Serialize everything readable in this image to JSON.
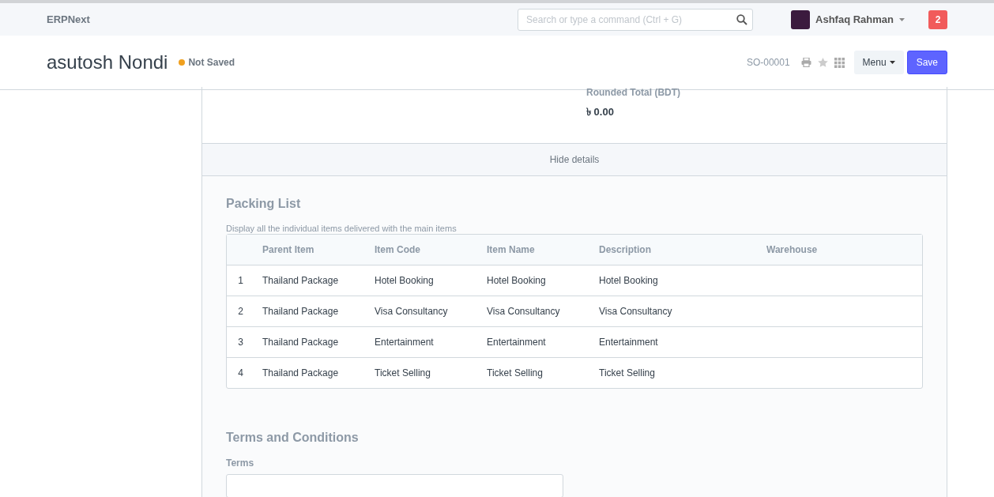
{
  "navbar": {
    "brand": "ERPNext",
    "search": {
      "placeholder": "Search or type a command (Ctrl + G)"
    },
    "user": {
      "name": "Ashfaq Rahman"
    },
    "notifications": "2"
  },
  "page_header": {
    "title": "asutosh Nondi",
    "status": {
      "label": "Not Saved",
      "color": "#f0a01e"
    },
    "doc_id": "SO-00001",
    "menu_label": "Menu",
    "save_label": "Save"
  },
  "totals": {
    "label": "Rounded Total (BDT)",
    "value": "৳ 0.00"
  },
  "toggle_details": "Hide details",
  "packing_list": {
    "title": "Packing List",
    "description": "Display all the individual items delivered with the main items",
    "columns": [
      "Parent Item",
      "Item Code",
      "Item Name",
      "Description",
      "Warehouse"
    ],
    "rows": [
      {
        "index": "1",
        "cells": [
          "Thailand Package",
          "Hotel Booking",
          "Hotel Booking",
          "Hotel Booking",
          ""
        ]
      },
      {
        "index": "2",
        "cells": [
          "Thailand Package",
          "Visa Consultancy",
          "Visa Consultancy",
          "Visa Consultancy",
          ""
        ]
      },
      {
        "index": "3",
        "cells": [
          "Thailand Package",
          "Entertainment",
          "Entertainment",
          "Entertainment",
          ""
        ]
      },
      {
        "index": "4",
        "cells": [
          "Thailand Package",
          "Ticket Selling",
          "Ticket Selling",
          "Ticket Selling",
          ""
        ]
      }
    ]
  },
  "terms": {
    "title": "Terms and Conditions",
    "field_label": "Terms"
  }
}
